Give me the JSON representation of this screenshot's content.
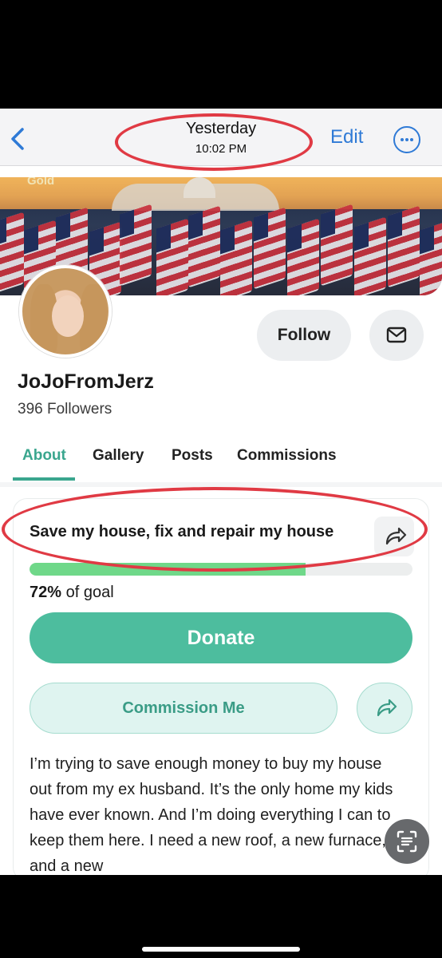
{
  "nav": {
    "title": "Yesterday",
    "subtitle": "10:02 PM",
    "edit_label": "Edit",
    "back_icon": "chevron-left-icon",
    "more_icon": "ellipsis-circle-icon"
  },
  "banner": {
    "badge": "Gold"
  },
  "profile": {
    "username": "JoJoFromJerz",
    "followers": "396 Followers",
    "follow_label": "Follow",
    "message_icon": "envelope-icon"
  },
  "tabs": [
    {
      "label": "About",
      "active": true
    },
    {
      "label": "Gallery",
      "active": false
    },
    {
      "label": "Posts",
      "active": false
    },
    {
      "label": "Commissions",
      "active": false
    }
  ],
  "goal": {
    "title": "Save my house, fix and repair my house",
    "progress_percent": 72,
    "percent_text": "72%",
    "of_goal_text": "of goal",
    "donate_label": "Donate",
    "commission_label": "Commission Me",
    "description": "I’m trying to save enough money to buy my house out from my ex husband. It’s the only home my kids have ever known. And I’m doing everything I can to keep them here. I need a new roof, a new furnace, and a new"
  },
  "colors": {
    "accent": "#4dbd9e",
    "link_blue": "#2f7ad6",
    "annotation_red": "#e03a44",
    "progress_green": "#6fd889"
  }
}
